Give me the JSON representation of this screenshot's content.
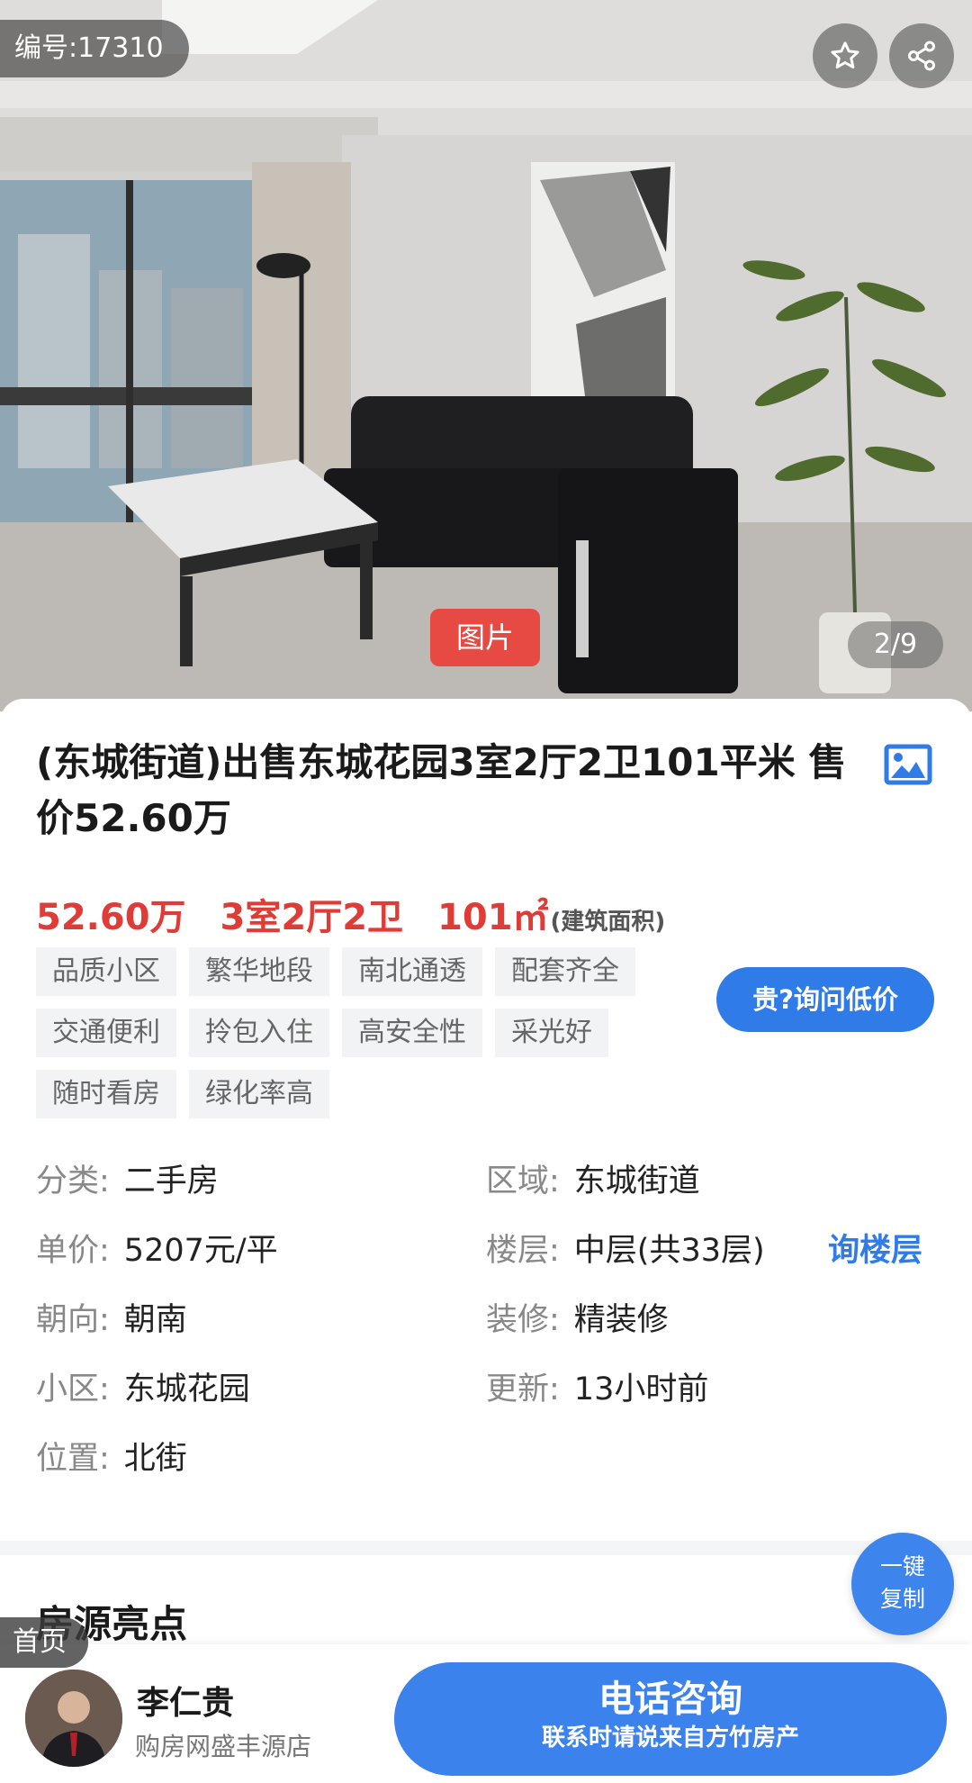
{
  "hero": {
    "listing_id": "编号:17310",
    "image_tag": "图片",
    "image_counter": "2/9",
    "favorite_icon": "star-icon",
    "share_icon": "share-icon"
  },
  "listing": {
    "title": "(东城街道)出售东城花园3室2厅2卫101平米 售价52.60万",
    "price": "52.60万",
    "layout": "3室2厅2卫",
    "area": "101㎡",
    "area_note": "(建筑面积)",
    "tags": [
      "品质小区",
      "繁华地段",
      "南北通透",
      "配套齐全",
      "交通便利",
      "拎包入住",
      "高安全性",
      "采光好",
      "随时看房",
      "绿化率高"
    ],
    "ask_price_button": "贵?询问低价",
    "details": {
      "category_key": "分类:",
      "category_val": "二手房",
      "district_key": "区域:",
      "district_val": "东城街道",
      "unit_price_key": "单价:",
      "unit_price_val": "5207元/平",
      "floor_key": "楼层:",
      "floor_val": "中层(共33层)",
      "ask_floor": "询楼层",
      "orientation_key": "朝向:",
      "orientation_val": "朝南",
      "decoration_key": "装修:",
      "decoration_val": "精装修",
      "community_key": "小区:",
      "community_val": "东城花园",
      "updated_key": "更新:",
      "updated_val": "13小时前",
      "location_key": "位置:",
      "location_val": "北街"
    },
    "highlights_title": "房源亮点",
    "copy_button_line1": "一键",
    "copy_button_line2": "复制"
  },
  "bottom_bar": {
    "home_tag": "首页",
    "agent_name": "李仁贵",
    "agent_shop": "购房网盛丰源店",
    "call_main": "电话咨询",
    "call_sub": "联系时请说来自方竹房产"
  },
  "colors": {
    "accent_blue": "#2f7be8",
    "price_red": "#e03c37",
    "tag_red": "#e64a43"
  }
}
